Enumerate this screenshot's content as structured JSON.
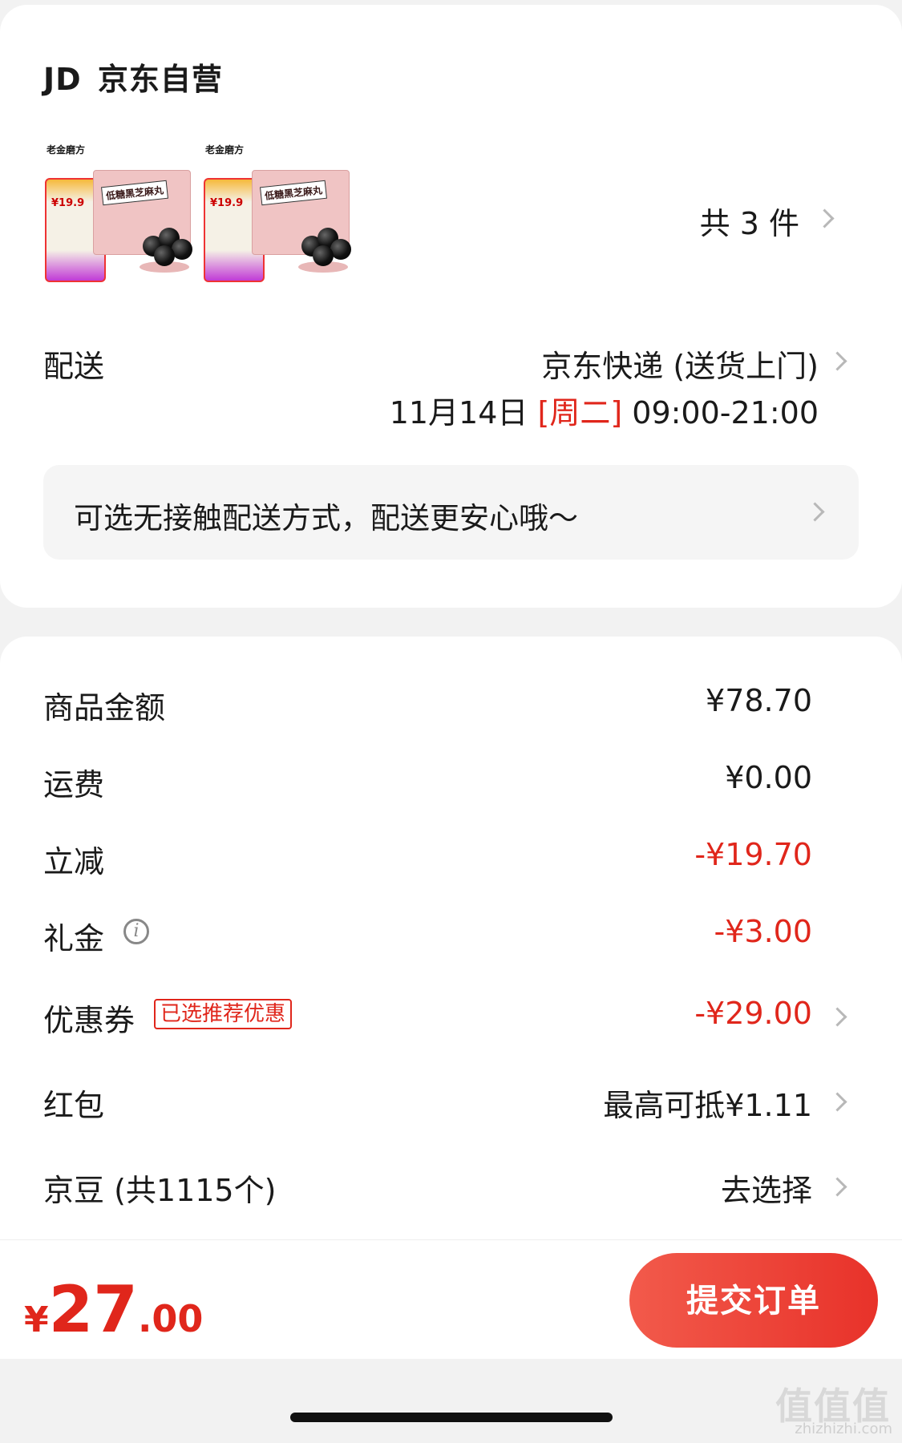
{
  "store": {
    "logo_text": "JD",
    "name": "京东自营"
  },
  "products": {
    "thumbnails": [
      {
        "brand": "老金磨方",
        "price_tag": "¥19.9",
        "box_label": "低糖黑芝麻丸"
      },
      {
        "brand": "老金磨方",
        "price_tag": "¥19.9",
        "box_label": "低糖黑芝麻丸"
      }
    ],
    "count_label": "共 3 件"
  },
  "delivery": {
    "label": "配送",
    "method": "京东快递 (送货上门)",
    "date": "11月14日",
    "weekday": "[周二]",
    "time_range": "09:00-21:00",
    "contactless_tip": "可选无接触配送方式，配送更安心哦～"
  },
  "summary": {
    "goods_amount": {
      "label": "商品金额",
      "value": "¥78.70"
    },
    "shipping": {
      "label": "运费",
      "value": "¥0.00"
    },
    "instant_discount": {
      "label": "立减",
      "value": "-¥19.70"
    },
    "gift_money": {
      "label": "礼金",
      "info_icon": "i",
      "value": "-¥3.00"
    },
    "coupon": {
      "label": "优惠券",
      "badge": "已选推荐优惠",
      "value": "-¥29.00"
    },
    "red_packet": {
      "label": "红包",
      "value": "最高可抵¥1.11"
    },
    "jd_beans": {
      "label": "京豆 (共1115个)",
      "value": "去选择"
    }
  },
  "checkout": {
    "currency": "¥",
    "total_integer": "27",
    "total_decimal": ".00",
    "submit_label": "提交订单"
  },
  "watermark": {
    "text": "值值值",
    "url": "zhizhizhi.com"
  },
  "colors": {
    "accent_red": "#e0261b",
    "button_gradient_start": "#f25a4b",
    "button_gradient_end": "#e8322a",
    "background": "#f2f2f2"
  },
  "icons": [
    "chevron-right-icon",
    "info-icon"
  ]
}
